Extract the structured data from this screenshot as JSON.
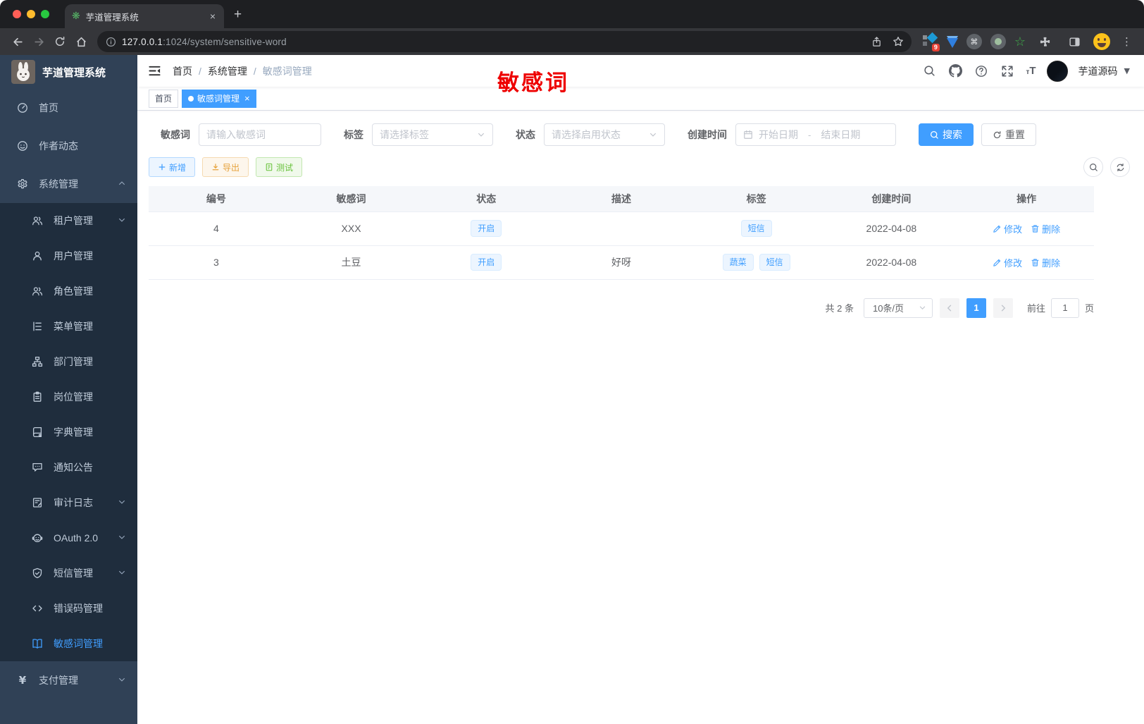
{
  "browser": {
    "tab_title": "芋道管理系统",
    "new_tab_label": "+",
    "close_tab_label": "×",
    "url_host": "127.0.0.1",
    "url_path": ":1024/system/sensitive-word",
    "extension_badge": "9",
    "cmd_glyph": "⌘",
    "star_glyph": "☆",
    "menu_glyph": "⋮"
  },
  "sidebar": {
    "title": "芋道管理系统",
    "items": [
      {
        "slug": "home",
        "label": "首页",
        "icon": "dashboard-icon",
        "level": 1
      },
      {
        "slug": "author-news",
        "label": "作者动态",
        "icon": "author-icon",
        "level": 1
      },
      {
        "slug": "system",
        "label": "系统管理",
        "icon": "gear-icon",
        "level": 1,
        "arrow": "up"
      },
      {
        "slug": "tenant",
        "label": "租户管理",
        "icon": "users-icon",
        "level": 2,
        "arrow": "down"
      },
      {
        "slug": "user",
        "label": "用户管理",
        "icon": "user-icon",
        "level": 2
      },
      {
        "slug": "role",
        "label": "角色管理",
        "icon": "users-icon",
        "level": 2
      },
      {
        "slug": "menu",
        "label": "菜单管理",
        "icon": "menu-tree-icon",
        "level": 2
      },
      {
        "slug": "dept",
        "label": "部门管理",
        "icon": "dept-tree-icon",
        "level": 2
      },
      {
        "slug": "post",
        "label": "岗位管理",
        "icon": "badge-icon",
        "level": 2
      },
      {
        "slug": "dict",
        "label": "字典管理",
        "icon": "dictionary-icon",
        "level": 2
      },
      {
        "slug": "notice",
        "label": "通知公告",
        "icon": "announcement-icon",
        "level": 2
      },
      {
        "slug": "audit-log",
        "label": "审计日志",
        "icon": "audit-log-icon",
        "level": 2,
        "arrow": "down"
      },
      {
        "slug": "oauth",
        "label": "OAuth 2.0",
        "icon": "robot-icon",
        "level": 2,
        "arrow": "down"
      },
      {
        "slug": "sms",
        "label": "短信管理",
        "icon": "shield-icon",
        "level": 2,
        "arrow": "down"
      },
      {
        "slug": "error-code",
        "label": "错误码管理",
        "icon": "code-icon",
        "level": 2
      },
      {
        "slug": "sensitive-word",
        "label": "敏感词管理",
        "icon": "open-book-icon",
        "level": 2,
        "active": true
      },
      {
        "slug": "pay",
        "label": "支付管理",
        "icon": "yen-icon",
        "level": 1,
        "arrow": "down"
      }
    ]
  },
  "navbar": {
    "breadcrumb": [
      "首页",
      "系统管理",
      "敏感词管理"
    ],
    "username": "芋道源码",
    "overlay_text": "敏感词"
  },
  "tags": [
    {
      "slug": "home",
      "label": "首页",
      "active": false,
      "closable": false
    },
    {
      "slug": "sensitive-word",
      "label": "敏感词管理",
      "active": true,
      "closable": true
    }
  ],
  "filters": {
    "keyword_label": "敏感词",
    "keyword_placeholder": "请输入敏感词",
    "tag_label": "标签",
    "tag_placeholder": "请选择标签",
    "status_label": "状态",
    "status_placeholder": "请选择启用状态",
    "date_label": "创建时间",
    "date_start_placeholder": "开始日期",
    "date_separator": "-",
    "date_end_placeholder": "结束日期",
    "search_label": "搜索",
    "reset_label": "重置"
  },
  "toolbar": {
    "add_label": "新增",
    "export_label": "导出",
    "test_label": "测试"
  },
  "table": {
    "columns": [
      "编号",
      "敏感词",
      "状态",
      "描述",
      "标签",
      "创建时间",
      "操作"
    ],
    "rows": [
      {
        "id": "4",
        "word": "XXX",
        "status": "开启",
        "desc": "",
        "tags": [
          "短信"
        ],
        "created": "2022-04-08"
      },
      {
        "id": "3",
        "word": "土豆",
        "status": "开启",
        "desc": "好呀",
        "tags": [
          "蔬菜",
          "短信"
        ],
        "created": "2022-04-08"
      }
    ],
    "edit_label": "修改",
    "delete_label": "删除"
  },
  "pagination": {
    "total_text": "共 2 条",
    "page_size_text": "10条/页",
    "current_page": "1",
    "goto_label": "前往",
    "goto_value": "1",
    "page_unit": "页"
  },
  "colors": {
    "accent": "#409eff",
    "sidebar_bg": "#304156",
    "submenu_bg": "#1f2d3d",
    "annotation_red": "#ee0000"
  }
}
